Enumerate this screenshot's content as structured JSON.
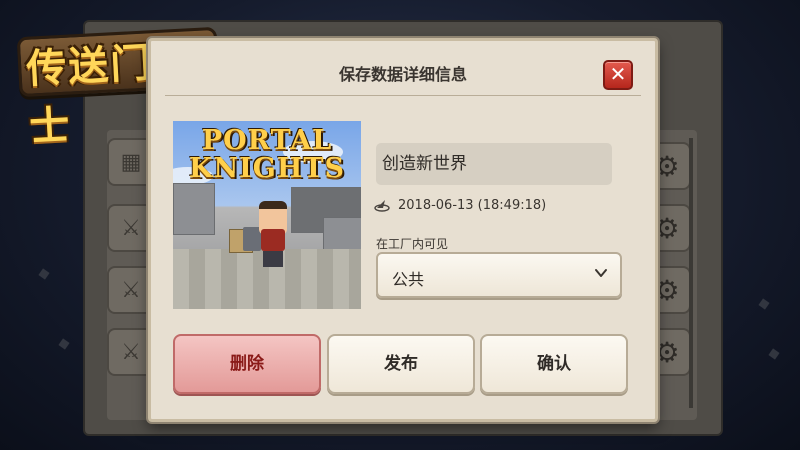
{
  "game": {
    "logo_text": "传送门骑士"
  },
  "dialog": {
    "title": "保存数据详细信息",
    "thumbnail": {
      "logo_line1": "PORTAL",
      "logo_line2": "KNIGHTS"
    },
    "world_name": "创造新世界",
    "timestamp": "2018-06-13 (18:49:18)",
    "visibility_label": "在工厂内可见",
    "visibility_value": "公共",
    "buttons": {
      "delete": "删除",
      "publish": "发布",
      "confirm": "确认"
    }
  },
  "colors": {
    "delete_button": "#e39a98",
    "close_button": "#c8322a",
    "dialog_bg": "#e7dfd1"
  },
  "icons": [
    "close-icon",
    "sundial-icon",
    "chevron-down-icon",
    "gear-icon",
    "block-icon",
    "sword-shield-icon"
  ]
}
